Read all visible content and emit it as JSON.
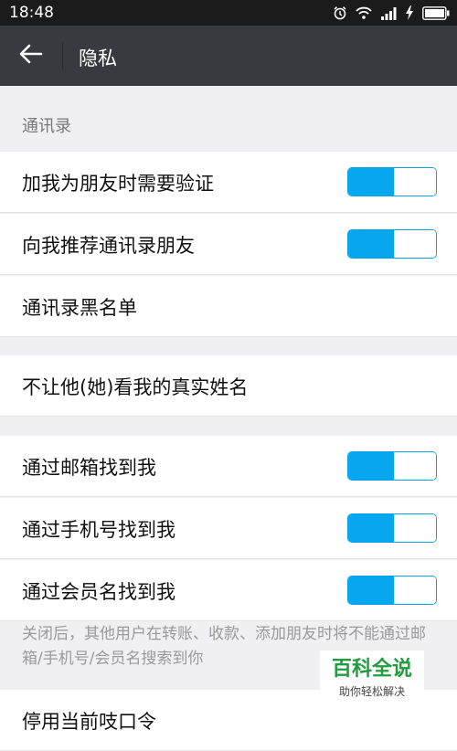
{
  "status_bar": {
    "time": "18:48",
    "icons": [
      "alarm-icon",
      "wifi-icon",
      "signal-icon",
      "charging-icon",
      "battery-icon"
    ]
  },
  "app_bar": {
    "back_icon": "back-arrow-icon",
    "title": "隐私"
  },
  "sections": {
    "contacts_header": "通讯录"
  },
  "rows": [
    {
      "label": "加我为朋友时需要验证",
      "toggle": true,
      "on": true
    },
    {
      "label": "向我推荐通讯录朋友",
      "toggle": true,
      "on": true
    },
    {
      "label": "通讯录黑名单",
      "toggle": false
    },
    {
      "label": "不让他(她)看我的真实姓名",
      "toggle": false
    },
    {
      "label": "通过邮箱找到我",
      "toggle": true,
      "on": true
    },
    {
      "label": "通过手机号找到我",
      "toggle": true,
      "on": true
    },
    {
      "label": "通过会员名找到我",
      "toggle": true,
      "on": true
    },
    {
      "label": "停用当前吱口令",
      "toggle": false
    }
  ],
  "note": "关闭后，其他用户在转账、收款、添加朋友时将不能通过邮箱/手机号/会员名搜索到你",
  "watermark": {
    "title": "百科全说",
    "subtitle": "助你轻松解决"
  },
  "colors": {
    "accent": "#06a7ef",
    "app_bar": "#393a3f",
    "background": "#efeff4"
  }
}
